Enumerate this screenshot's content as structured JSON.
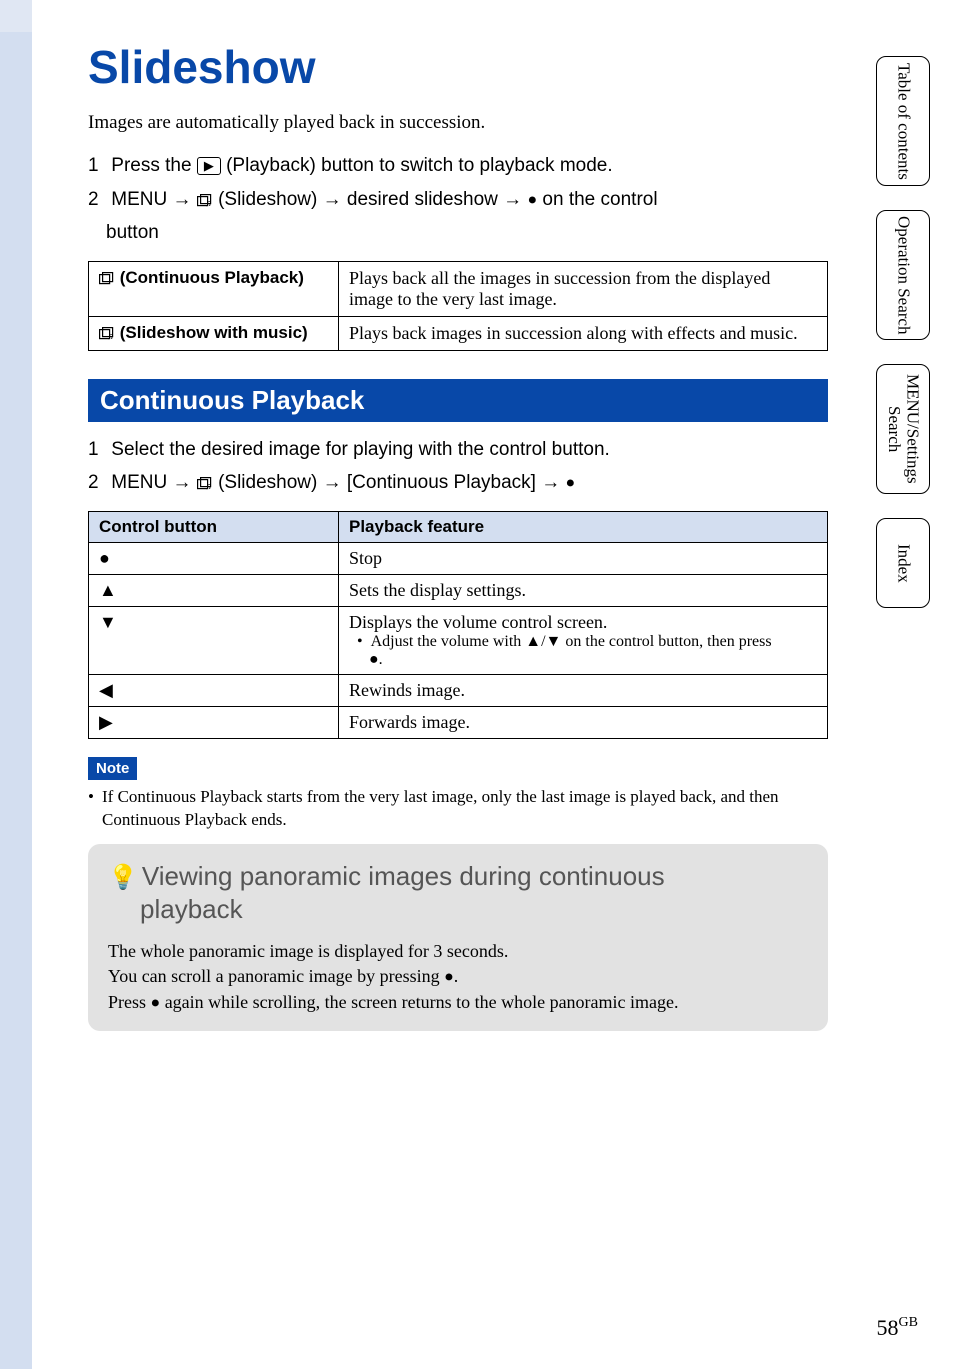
{
  "page": {
    "title": "Slideshow",
    "intro": "Images are automatically played back in succession.",
    "steps": [
      {
        "num": "1",
        "text_before": "Press the ",
        "icon": "▶",
        "text_after": " (Playback) button to switch to playback mode."
      },
      {
        "num": "2",
        "text": "MENU → ",
        "mid1": " (Slideshow) → desired slideshow → ",
        "mid2": " on the control",
        "line2": "button"
      }
    ]
  },
  "modes_table": {
    "rows": [
      {
        "label": " (Continuous Playback)",
        "desc": "Plays back all the images in succession from the displayed image to the very last image."
      },
      {
        "label": " (Slideshow with music)",
        "desc": "Plays back images in succession along with effects and music."
      }
    ]
  },
  "section": {
    "heading": "Continuous Playback",
    "steps": [
      {
        "num": "1",
        "text": "Select the desired image for playing with the control button."
      },
      {
        "num": "2",
        "text_before": "MENU → ",
        "text_mid": " (Slideshow) → [Continuous Playback] → "
      }
    ]
  },
  "control_table": {
    "headers": {
      "col1": "Control button",
      "col2": "Playback feature"
    },
    "rows": [
      {
        "sym": "●",
        "feat": "Stop"
      },
      {
        "sym": "▲",
        "feat": "Sets the display settings."
      },
      {
        "sym": "▼",
        "feat_line1": "Displays the volume control screen.",
        "feat_bullet": "Adjust the volume with ▲/▼ on the control button, then press",
        "feat_bullet2": "●."
      },
      {
        "sym": "◀",
        "feat": "Rewinds image."
      },
      {
        "sym": "▶",
        "feat": "Forwards image."
      }
    ]
  },
  "note": {
    "tag": "Note",
    "body": "If Continuous Playback starts from the very last image, only the last image is played back, and then Continuous Playback ends."
  },
  "tip": {
    "title_line1": "Viewing panoramic images during continuous",
    "title_line2": "playback",
    "body_line1": "The whole panoramic image is displayed for 3 seconds.",
    "body_line2_a": "You can scroll a panoramic image by pressing ",
    "body_line2_b": ".",
    "body_line3_a": "Press ",
    "body_line3_b": " again while scrolling, the screen returns to the whole panoramic image."
  },
  "side_tabs": [
    "Table of contents",
    "Operation Search",
    "MENU/Settings Search",
    "Index"
  ],
  "footer": {
    "page_num": "58",
    "suffix": "GB"
  },
  "glyphs": {
    "center": "●",
    "arrow": "→",
    "bulb": "❋"
  }
}
